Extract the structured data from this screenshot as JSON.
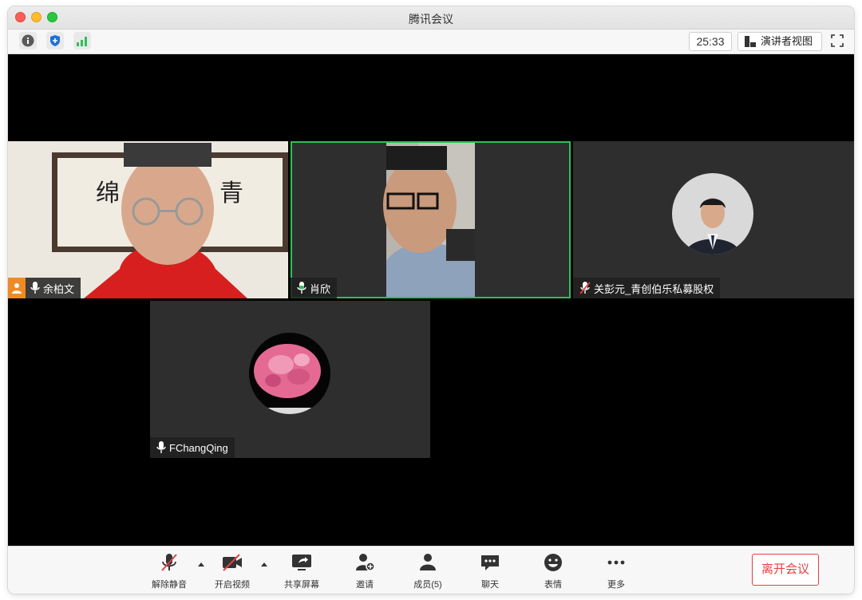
{
  "window": {
    "title": "腾讯会议"
  },
  "toolbar_top": {
    "timer": "25:33",
    "presenter_view_label": "演讲者视图"
  },
  "participants": [
    {
      "name": "余柏文",
      "mic": "on",
      "host": true
    },
    {
      "name": "肖欣",
      "mic": "on",
      "active_speaker": true
    },
    {
      "name": "关彭元_青创伯乐私募股权",
      "mic": "muted"
    },
    {
      "name": "FChangQing",
      "mic": "on"
    }
  ],
  "video_text": {
    "calligraphy_left": "绵",
    "calligraphy_right": "青"
  },
  "controls": {
    "unmute": "解除静音",
    "start_video": "开启视频",
    "share_screen": "共享屏幕",
    "invite": "邀请",
    "members": "成员(5)",
    "chat": "聊天",
    "reactions": "表情",
    "more": "更多",
    "leave": "离开会议"
  },
  "colors": {
    "active_border": "#2fbf5a",
    "leave": "#e04343",
    "signal": "#2fbf5a",
    "security": "#1e6fd9"
  }
}
